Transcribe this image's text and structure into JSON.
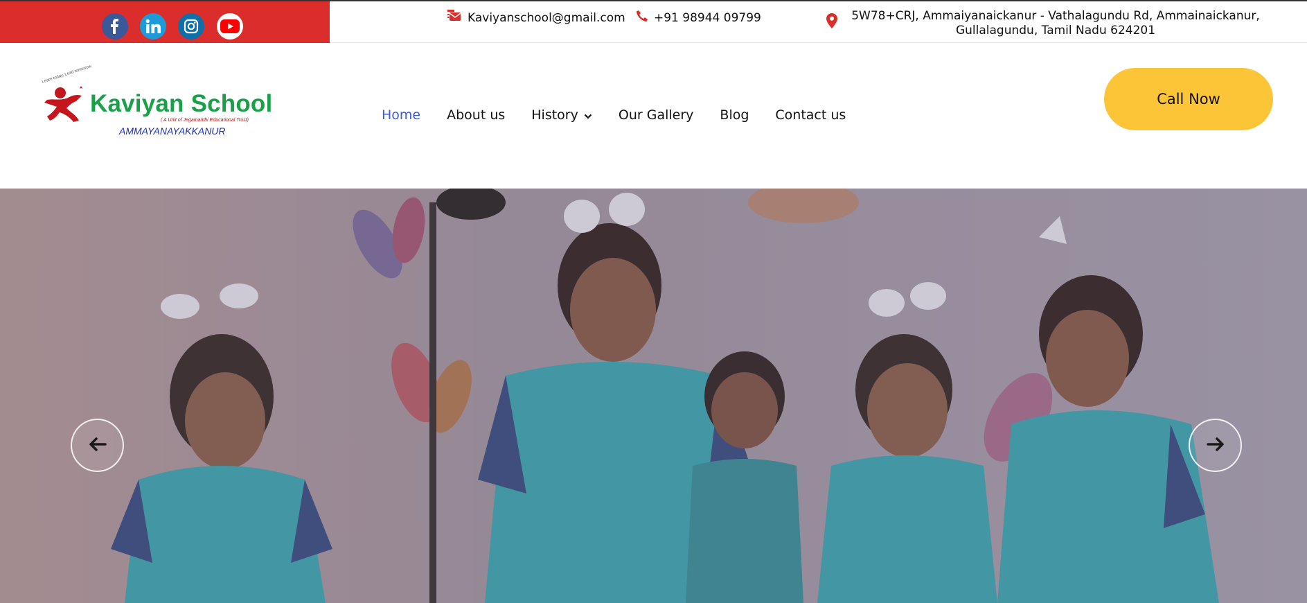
{
  "social": {
    "items": [
      {
        "name": "facebook",
        "icon": "facebook-icon",
        "color": "#3b5998"
      },
      {
        "name": "linkedin",
        "icon": "linkedin-icon",
        "color": "#1d9bd9"
      },
      {
        "name": "instagram",
        "icon": "instagram-icon",
        "color": "#0f6fa8"
      },
      {
        "name": "youtube",
        "icon": "youtube-icon",
        "color": "#ff0000"
      }
    ],
    "strip_color": "#db2d2b"
  },
  "contact": {
    "email": "Kaviyanschool@gmail.com",
    "phone": "+91 98944 09799",
    "address_line1": "5W78+CRJ, Ammaiyanaickanur - Vathalagundu Rd, Ammainaickanur,",
    "address_line2": "Gullalagundu, Tamil Nadu 624201"
  },
  "logo": {
    "title": "Kaviyan School",
    "subtitle": "( A Unit of Jegamanthi Educational Trust)",
    "place": "AMMAYANAYAKKANUR",
    "tagline": "Learn today, Lead tomorrow"
  },
  "nav": {
    "items": [
      {
        "label": "Home",
        "active": true
      },
      {
        "label": "About us",
        "active": false
      },
      {
        "label": "History",
        "active": false,
        "has_dropdown": true
      },
      {
        "label": "Our Gallery",
        "active": false
      },
      {
        "label": "Blog",
        "active": false
      },
      {
        "label": "Contact us",
        "active": false
      }
    ],
    "active_color": "#3c5bd4"
  },
  "cta": {
    "label": "Call Now",
    "color": "#fcc537"
  },
  "hero": {
    "prev_icon": "arrow-left-icon",
    "next_icon": "arrow-right-icon"
  }
}
